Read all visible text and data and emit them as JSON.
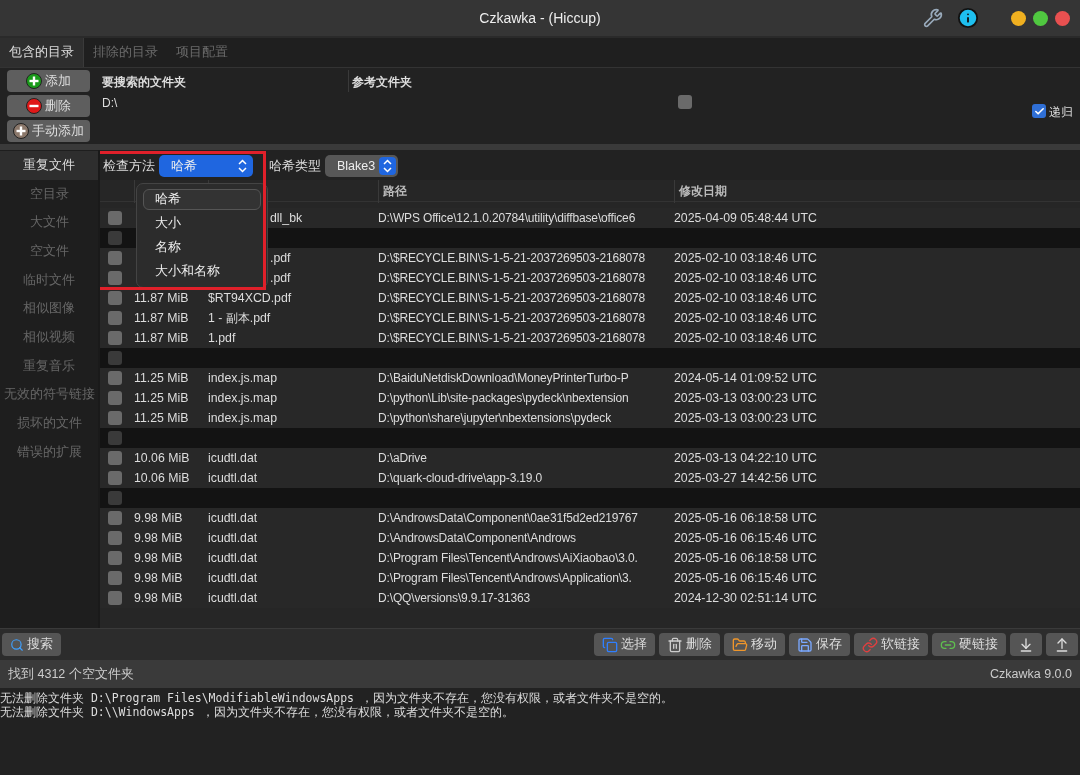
{
  "window": {
    "title": "Czkawka - (Hiccup)"
  },
  "tabs": [
    {
      "label": "包含的目录",
      "selected": true
    },
    {
      "label": "排除的目录",
      "selected": false
    },
    {
      "label": "项目配置",
      "selected": false
    }
  ],
  "directory_actions": [
    {
      "kind": "add",
      "label": "添加"
    },
    {
      "kind": "remove",
      "label": "删除"
    },
    {
      "kind": "manual",
      "label": "手动添加"
    }
  ],
  "directory_table": {
    "columns": [
      "要搜索的文件夹",
      "参考文件夹"
    ],
    "rows": [
      {
        "path": "D:\\",
        "reference": false
      }
    ]
  },
  "recursive": {
    "label": "递归",
    "checked": true
  },
  "sidebar": {
    "items": [
      {
        "label": "重复文件",
        "selected": true
      },
      {
        "label": "空目录",
        "selected": false
      },
      {
        "label": "大文件",
        "selected": false
      },
      {
        "label": "空文件",
        "selected": false
      },
      {
        "label": "临时文件",
        "selected": false
      },
      {
        "label": "相似图像",
        "selected": false
      },
      {
        "label": "相似视频",
        "selected": false
      },
      {
        "label": "重复音乐",
        "selected": false
      },
      {
        "label": "无效的符号链接",
        "selected": false
      },
      {
        "label": "损坏的文件",
        "selected": false
      },
      {
        "label": "错误的扩展",
        "selected": false
      }
    ]
  },
  "check_method": {
    "label": "检查方法",
    "value": "哈希"
  },
  "hash_type": {
    "label": "哈希类型",
    "value": "Blake3"
  },
  "method_dropdown": {
    "options": [
      {
        "label": "哈希",
        "selected": true
      },
      {
        "label": "大小",
        "selected": false
      },
      {
        "label": "名称",
        "selected": false
      },
      {
        "label": "大小和名称",
        "selected": false
      }
    ]
  },
  "results": {
    "columns": [
      "路径",
      "修改日期"
    ],
    "rows": [
      {
        "kind": "file",
        "checked": false,
        "name": "dll_bk",
        "path": "D:\\WPS Office\\12.1.0.20784\\utility\\diffbase\\office6",
        "date": "2025-04-09 05:48:44 UTC"
      },
      {
        "kind": "group",
        "checked": false
      },
      {
        "kind": "file",
        "checked": false,
        "name": ".pdf",
        "path": "D:\\$RECYCLE.BIN\\S-1-5-21-2037269503-2168078",
        "date": "2025-02-10 03:18:46 UTC"
      },
      {
        "kind": "file",
        "checked": false,
        "name": ".pdf",
        "path": "D:\\$RECYCLE.BIN\\S-1-5-21-2037269503-2168078",
        "date": "2025-02-10 03:18:46 UTC"
      },
      {
        "kind": "file",
        "checked": false,
        "size": "11.87 MiB",
        "name": "$RT94XCD.pdf",
        "path": "D:\\$RECYCLE.BIN\\S-1-5-21-2037269503-2168078",
        "date": "2025-02-10 03:18:46 UTC"
      },
      {
        "kind": "file",
        "checked": false,
        "size": "11.87 MiB",
        "name": "1 - 副本.pdf",
        "path": "D:\\$RECYCLE.BIN\\S-1-5-21-2037269503-2168078",
        "date": "2025-02-10 03:18:46 UTC"
      },
      {
        "kind": "file",
        "checked": false,
        "size": "11.87 MiB",
        "name": "1.pdf",
        "path": "D:\\$RECYCLE.BIN\\S-1-5-21-2037269503-2168078",
        "date": "2025-02-10 03:18:46 UTC"
      },
      {
        "kind": "group",
        "checked": false
      },
      {
        "kind": "file",
        "checked": false,
        "size": "11.25 MiB",
        "name": "index.js.map",
        "path": "D:\\BaiduNetdiskDownload\\MoneyPrinterTurbo-P",
        "date": "2024-05-14 01:09:52 UTC"
      },
      {
        "kind": "file",
        "checked": false,
        "size": "11.25 MiB",
        "name": "index.js.map",
        "path": "D:\\python\\Lib\\site-packages\\pydeck\\nbextension",
        "date": "2025-03-13 03:00:23 UTC"
      },
      {
        "kind": "file",
        "checked": false,
        "size": "11.25 MiB",
        "name": "index.js.map",
        "path": "D:\\python\\share\\jupyter\\nbextensions\\pydeck",
        "date": "2025-03-13 03:00:23 UTC"
      },
      {
        "kind": "group",
        "checked": false
      },
      {
        "kind": "file",
        "checked": false,
        "size": "10.06 MiB",
        "name": "icudtl.dat",
        "path": "D:\\aDrive",
        "date": "2025-03-13 04:22:10 UTC"
      },
      {
        "kind": "file",
        "checked": false,
        "size": "10.06 MiB",
        "name": "icudtl.dat",
        "path": "D:\\quark-cloud-drive\\app-3.19.0",
        "date": "2025-03-27 14:42:56 UTC"
      },
      {
        "kind": "group",
        "checked": false
      },
      {
        "kind": "file",
        "checked": false,
        "size": "9.98 MiB",
        "name": "icudtl.dat",
        "path": "D:\\AndrowsData\\Component\\0ae31f5d2ed219767",
        "date": "2025-05-16 06:18:58 UTC"
      },
      {
        "kind": "file",
        "checked": false,
        "size": "9.98 MiB",
        "name": "icudtl.dat",
        "path": "D:\\AndrowsData\\Component\\Androws",
        "date": "2025-05-16 06:15:46 UTC"
      },
      {
        "kind": "file",
        "checked": false,
        "size": "9.98 MiB",
        "name": "icudtl.dat",
        "path": "D:\\Program Files\\Tencent\\Androws\\AiXiaobao\\3.0.",
        "date": "2025-05-16 06:18:58 UTC"
      },
      {
        "kind": "file",
        "checked": false,
        "size": "9.98 MiB",
        "name": "icudtl.dat",
        "path": "D:\\Program Files\\Tencent\\Androws\\Application\\3.",
        "date": "2025-05-16 06:15:46 UTC"
      },
      {
        "kind": "file",
        "checked": false,
        "size": "9.98 MiB",
        "name": "icudtl.dat",
        "path": "D:\\QQ\\versions\\9.9.17-31363",
        "date": "2024-12-30 02:51:14 UTC"
      }
    ]
  },
  "search_button": "搜索",
  "actions": [
    {
      "kind": "select",
      "label": "选择"
    },
    {
      "kind": "delete",
      "label": "删除"
    },
    {
      "kind": "move",
      "label": "移动"
    },
    {
      "kind": "save",
      "label": "保存"
    },
    {
      "kind": "symlink",
      "label": "软链接"
    },
    {
      "kind": "hardlink",
      "label": "硬链接"
    },
    {
      "kind": "sort"
    },
    {
      "kind": "export"
    }
  ],
  "status": {
    "message": "找到 4312 个空文件夹",
    "version": "Czkawka 9.0.0"
  },
  "log": [
    "无法删除文件夹 D:\\Program Files\\ModifiableWindowsApps ，因为文件夹不存在，您没有权限，或者文件夹不是空的。",
    "无法删除文件夹 D:\\\\WindowsApps ，因为文件夹不存在，您没有权限，或者文件夹不是空的。"
  ]
}
